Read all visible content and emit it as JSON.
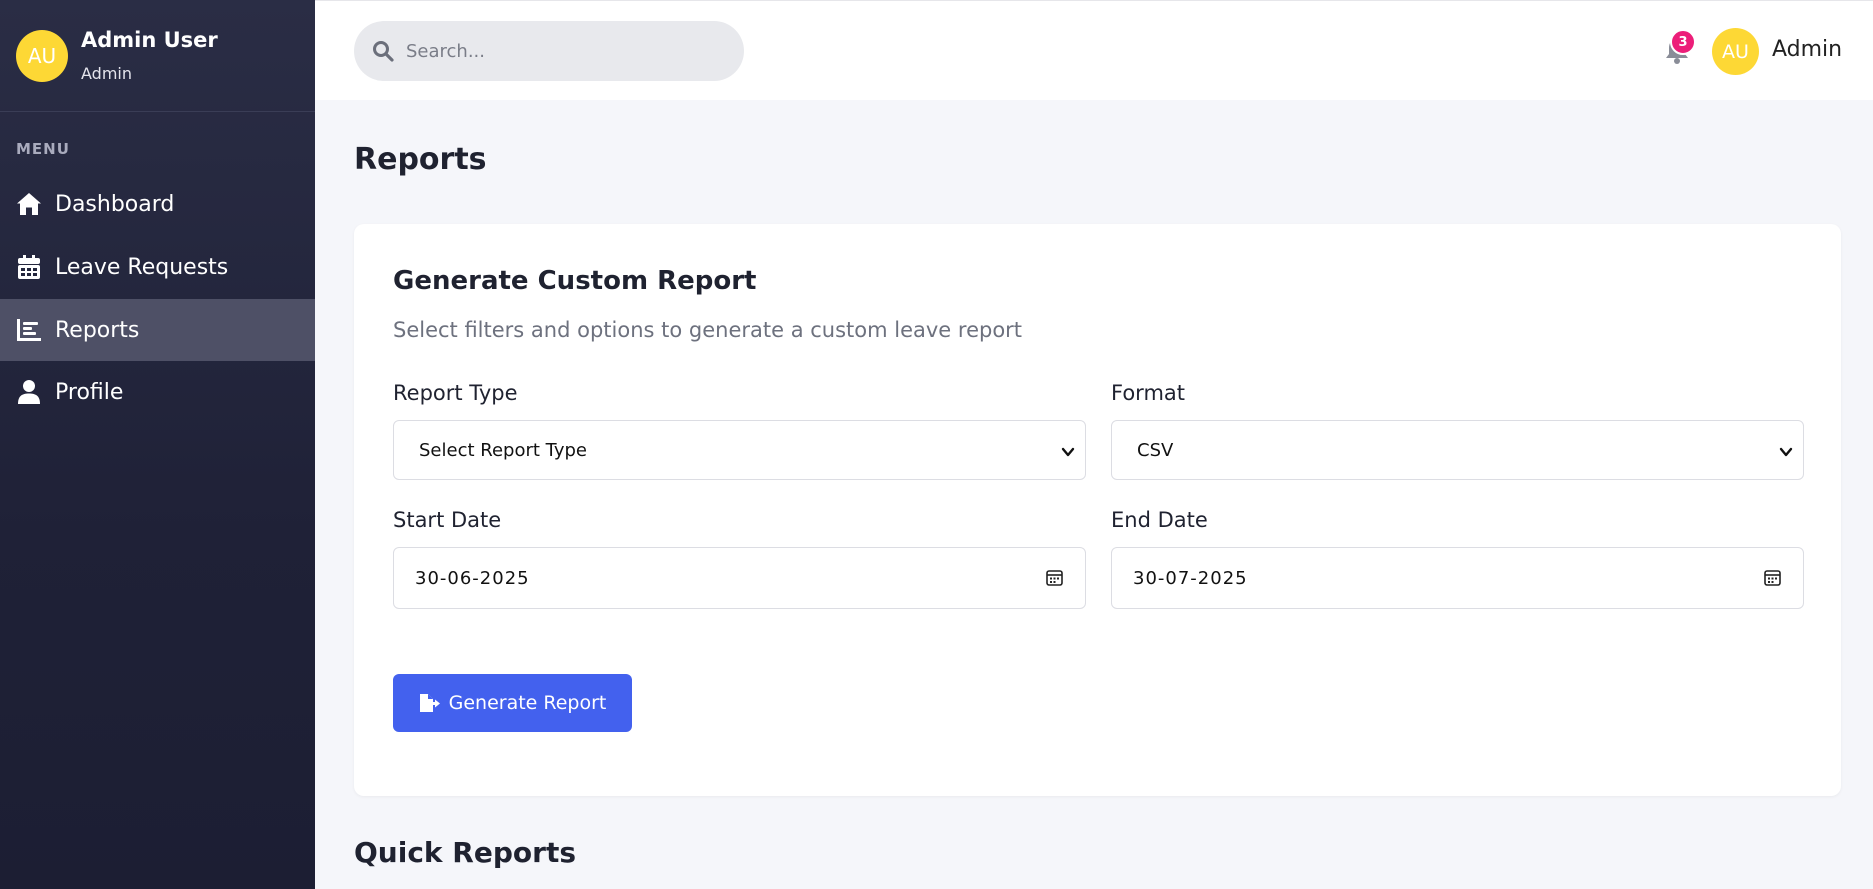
{
  "sidebar": {
    "user": {
      "initials": "AU",
      "name": "Admin User",
      "role": "Admin"
    },
    "menu_label": "MENU",
    "items": [
      {
        "label": "Dashboard",
        "icon": "home-icon",
        "active": false
      },
      {
        "label": "Leave Requests",
        "icon": "calendar-icon",
        "active": false
      },
      {
        "label": "Reports",
        "icon": "chart-icon",
        "active": true
      },
      {
        "label": "Profile",
        "icon": "user-icon",
        "active": false
      }
    ]
  },
  "topbar": {
    "search": {
      "placeholder": "Search...",
      "value": ""
    },
    "notifications": {
      "count": "3",
      "icon": "bell-icon"
    },
    "user": {
      "initials": "AU",
      "name": "Admin"
    }
  },
  "page": {
    "title": "Reports",
    "card": {
      "title": "Generate Custom Report",
      "subtitle": "Select filters and options to generate a custom leave report",
      "report_type": {
        "label": "Report Type",
        "value": "Select Report Type"
      },
      "format": {
        "label": "Format",
        "value": "CSV"
      },
      "start_date": {
        "label": "Start Date",
        "value": "30-06-2025"
      },
      "end_date": {
        "label": "End Date",
        "value": "30-07-2025"
      },
      "generate_button": "Generate Report"
    },
    "quick_reports_title": "Quick Reports"
  },
  "colors": {
    "sidebar_bg": "#23263d",
    "active_item": "#4e5066",
    "accent": "#4361ee",
    "avatar": "#fdd835",
    "badge": "#ec1e79",
    "page_bg": "#f5f6fa"
  }
}
